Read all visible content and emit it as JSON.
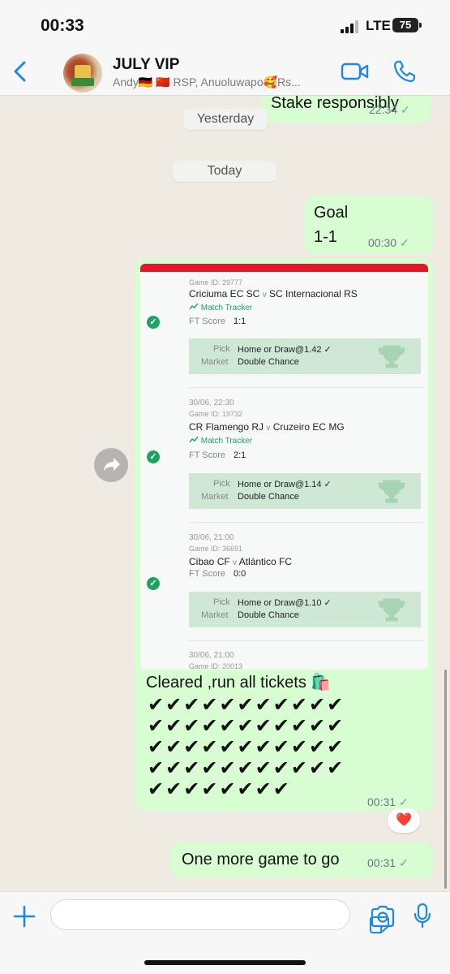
{
  "status_bar": {
    "time": "00:33",
    "network": "LTE",
    "battery": "75"
  },
  "header": {
    "title": "JULY VIP",
    "subtitle": "Andy🇩🇪 🇨🇳 RSP, Anuoluwapo🥰Rs..."
  },
  "messages": {
    "m1": {
      "text": "Stake responsibly",
      "time": "22:34",
      "tick": "✓"
    },
    "date_yesterday": "Yesterday",
    "date_today": "Today",
    "m2": {
      "line1": "Goal",
      "line2": "1-1",
      "time": "00:30",
      "tick": "✓"
    },
    "m3": {
      "caption": "Cleared ,run all tickets 🛍️",
      "check_rows": [
        "✔✔✔✔✔✔✔✔✔✔✔",
        "✔✔✔✔✔✔✔✔✔✔✔",
        "✔✔✔✔✔✔✔✔✔✔✔",
        "✔✔✔✔✔✔✔✔✔✔✔",
        "✔✔✔✔✔✔✔✔"
      ],
      "time": "00:31",
      "tick": "✓",
      "reaction": "❤️"
    },
    "m4": {
      "text": "One more game to go",
      "time": "00:31",
      "tick": "✓"
    }
  },
  "ticket_image": {
    "tickets": [
      {
        "date": "",
        "game_id": "Game ID: 29777",
        "home": "Criciuma EC SC",
        "away": "SC Internacional RS",
        "tracker": "Match Tracker",
        "score_label": "FT Score",
        "score": "1:1",
        "pick_label": "Pick",
        "pick": "Home or Draw@1.42 ✓",
        "market_label": "Market",
        "market": "Double Chance"
      },
      {
        "date": "30/06, 22:30",
        "game_id": "Game ID: 19732",
        "home": "CR Flamengo RJ",
        "away": "Cruzeiro EC MG",
        "tracker": "Match Tracker",
        "score_label": "FT Score",
        "score": "2:1",
        "pick_label": "Pick",
        "pick": "Home or Draw@1.14 ✓",
        "market_label": "Market",
        "market": "Double Chance"
      },
      {
        "date": "30/06, 21:00",
        "game_id": "Game ID: 36691",
        "home": "Cibao CF",
        "away": "Atlántico FC",
        "tracker": "",
        "score_label": "FT Score",
        "score": "0:0",
        "pick_label": "Pick",
        "pick": "Home or Draw@1.10 ✓",
        "market_label": "Market",
        "market": "Double Chance"
      },
      {
        "date": "30/06, 21:00",
        "game_id": "Game ID: 20013"
      }
    ],
    "versus": "v"
  },
  "colors": {
    "outgoing_bubble": "#d9fdd3",
    "accent": "#1e88e5",
    "win_green": "#1ea362",
    "ticket_red": "#e4162a"
  }
}
